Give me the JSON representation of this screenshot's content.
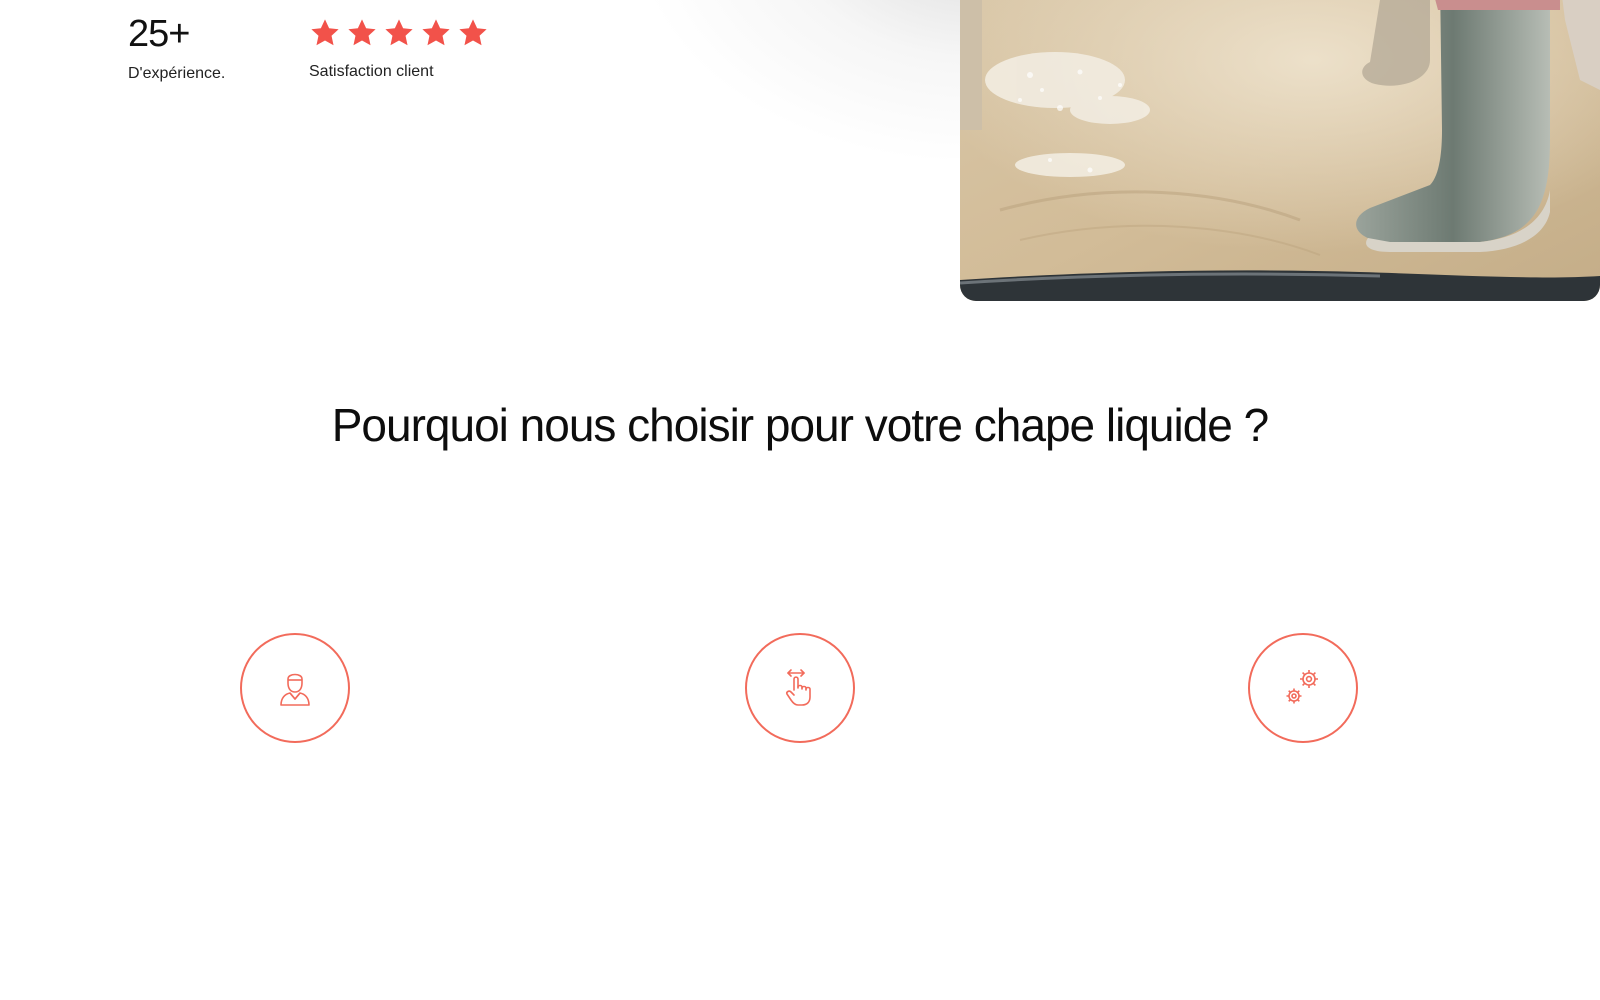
{
  "stats": {
    "experience": {
      "value": "25+",
      "label": "D'expérience."
    },
    "satisfaction": {
      "rating": 5,
      "rating_max": 5,
      "label": "Satisfaction client",
      "star_color": "#f2524a"
    }
  },
  "hero_image": {
    "icon": "worker-boots-liquid-screed-photo"
  },
  "section": {
    "title": "Pourquoi nous choisir pour votre chape liquide ?"
  },
  "features": [
    {
      "icon": "worker-icon"
    },
    {
      "icon": "touch-gesture-icon"
    },
    {
      "icon": "gears-icon"
    }
  ],
  "colors": {
    "accent": "#f26b5b",
    "text": "#111111",
    "background": "#ffffff"
  }
}
